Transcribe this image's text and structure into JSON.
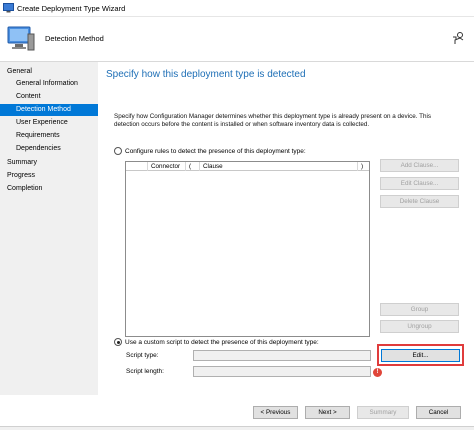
{
  "window": {
    "title": "Create Deployment Type Wizard"
  },
  "header": {
    "page_name": "Detection Method"
  },
  "nav": {
    "items": [
      {
        "label": "General",
        "level": "top",
        "active": false
      },
      {
        "label": "General Information",
        "level": "sub",
        "active": false
      },
      {
        "label": "Content",
        "level": "sub",
        "active": false
      },
      {
        "label": "Detection Method",
        "level": "sub",
        "active": true
      },
      {
        "label": "User Experience",
        "level": "sub",
        "active": false
      },
      {
        "label": "Requirements",
        "level": "sub",
        "active": false
      },
      {
        "label": "Dependencies",
        "level": "sub",
        "active": false
      },
      {
        "label": "Summary",
        "level": "top",
        "active": false
      },
      {
        "label": "Progress",
        "level": "top",
        "active": false
      },
      {
        "label": "Completion",
        "level": "top",
        "active": false
      }
    ]
  },
  "main": {
    "heading": "Specify how this deployment type is detected",
    "description": "Specify how Configuration Manager determines whether this deployment type is already present on a device. This detection occurs before the content is installed or when software inventory data is collected.",
    "option_rules_label": "Configure rules to detect the presence of this deployment type:",
    "option_script_label": "Use a custom script to detect the presence of this deployment type:",
    "table_columns": [
      "",
      "Connector",
      "(",
      "Clause",
      ")"
    ],
    "buttons": {
      "add_clause": "Add Clause...",
      "edit_clause": "Edit Clause...",
      "delete_clause": "Delete Clause",
      "group": "Group",
      "ungroup": "Ungroup",
      "edit": "Edit..."
    },
    "script_type_label": "Script type:",
    "script_type_value": "",
    "script_length_label": "Script length:",
    "script_length_value": "",
    "error_glyph": "!"
  },
  "footer": {
    "previous": "< Previous",
    "next": "Next >",
    "summary": "Summary",
    "cancel": "Cancel"
  },
  "colors": {
    "accent": "#0078d7",
    "heading": "#1e6fb6",
    "highlight": "#e03c3c"
  }
}
